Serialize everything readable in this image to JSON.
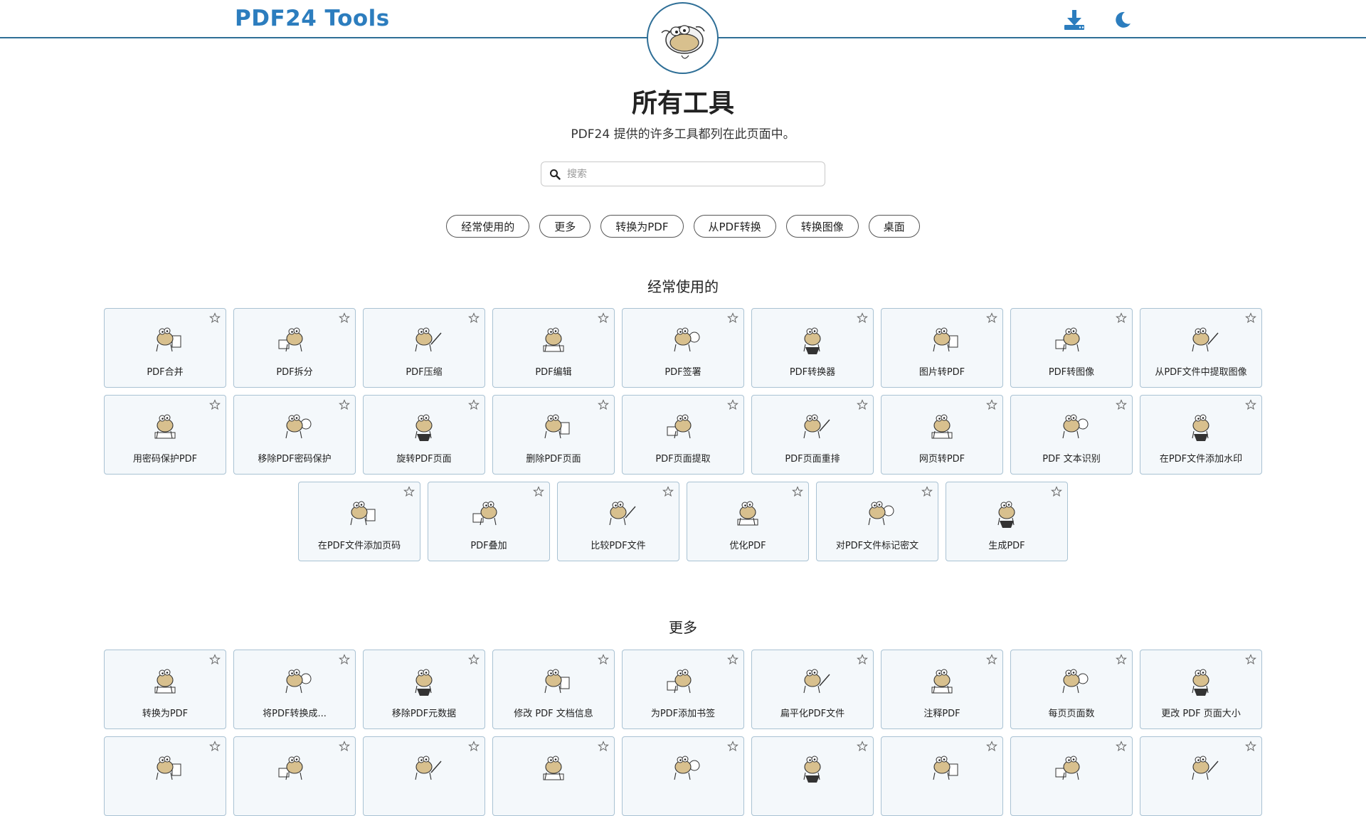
{
  "header": {
    "brand": "PDF24 Tools",
    "download_icon": "download-icon",
    "theme_icon": "moon-icon"
  },
  "hero": {
    "title": "所有工具",
    "subtitle": "PDF24 提供的许多工具都列在此页面中。"
  },
  "search": {
    "placeholder": "搜索",
    "value": ""
  },
  "categories": [
    "经常使用的",
    "更多",
    "转换为PDF",
    "从PDF转换",
    "转换图像",
    "桌面"
  ],
  "sections": [
    {
      "title": "经常使用的",
      "tools": [
        "PDF合并",
        "PDF拆分",
        "PDF压缩",
        "PDF编辑",
        "PDF签署",
        "PDF转换器",
        "图片转PDF",
        "PDF转图像",
        "从PDF文件中提取图像",
        "用密码保护PDF",
        "移除PDF密码保护",
        "旋转PDF页面",
        "删除PDF页面",
        "PDF页面提取",
        "PDF页面重排",
        "网页转PDF",
        "PDF 文本识别",
        "在PDF文件添加水印",
        "在PDF文件添加页码",
        "PDF叠加",
        "比较PDF文件",
        "优化PDF",
        "对PDF文件标记密文",
        "生成PDF"
      ]
    },
    {
      "title": "更多",
      "tools": [
        "转换为PDF",
        "将PDF转换成...",
        "移除PDF元数据",
        "修改 PDF 文档信息",
        "为PDF添加书签",
        "扁平化PDF文件",
        "注释PDF",
        "每页页面数",
        "更改 PDF 页面大小",
        "",
        "",
        "",
        "",
        "",
        "",
        "",
        "",
        ""
      ]
    }
  ],
  "colors": {
    "brand": "#2c7dbe",
    "header_line": "#2f6f97",
    "tile_bg": "#f4f8fb",
    "tile_border": "#a9c2d3"
  }
}
